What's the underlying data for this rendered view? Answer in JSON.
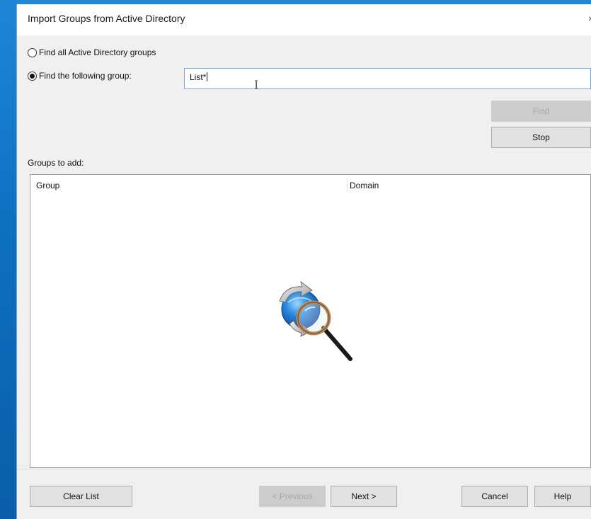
{
  "dialog": {
    "title": "Import Groups from Active Directory",
    "close_glyph": "×"
  },
  "search": {
    "option_all_label": "Find all Active Directory groups",
    "option_all_checked": false,
    "option_following_label": "Find the following group:",
    "option_following_checked": true,
    "query_value": "List*"
  },
  "actions": {
    "find_label": "Find",
    "find_enabled": false,
    "stop_label": "Stop"
  },
  "results": {
    "section_label": "Groups to add:",
    "columns": [
      "Group",
      "Domain"
    ],
    "rows": [],
    "status_icon": "directory-search-icon"
  },
  "footer": {
    "clear_list_label": "Clear List",
    "previous_label": "< Previous",
    "previous_enabled": false,
    "next_label": "Next >",
    "cancel_label": "Cancel",
    "help_label": "Help"
  },
  "colors": {
    "desktop": "#0e6fbf",
    "dialog_bg": "#f0f0f0",
    "input_border": "#7aa7d8"
  }
}
